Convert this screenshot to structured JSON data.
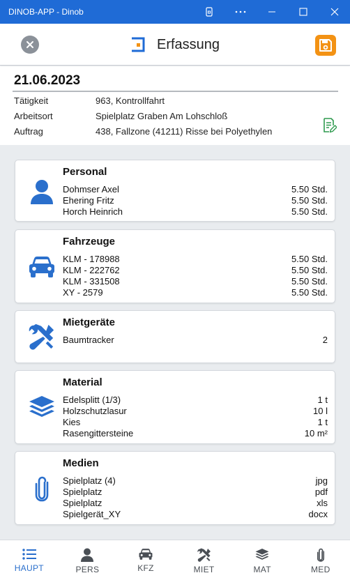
{
  "window": {
    "title": "DINOB-APP - Dinob"
  },
  "header": {
    "title": "Erfassung"
  },
  "info": {
    "date": "21.06.2023",
    "rows": [
      {
        "label": "Tätigkeit",
        "value": "963, Kontrollfahrt"
      },
      {
        "label": "Arbeitsort",
        "value": "Spielplatz Graben Am Lohschloß"
      },
      {
        "label": "Auftrag",
        "value": "438, Fallzone (41211) Risse bei Polyethylen"
      }
    ]
  },
  "cards": [
    {
      "title": "Personal",
      "icon": "person-icon",
      "items": [
        {
          "name": "Dohmser Axel",
          "value": "5.50 Std."
        },
        {
          "name": "Ehering Fritz",
          "value": "5.50 Std."
        },
        {
          "name": "Horch Heinrich",
          "value": "5.50 Std."
        }
      ]
    },
    {
      "title": "Fahrzeuge",
      "icon": "car-icon",
      "items": [
        {
          "name": "KLM - 178988",
          "value": "5.50 Std."
        },
        {
          "name": "KLM - 222762",
          "value": "5.50 Std."
        },
        {
          "name": "KLM - 331508",
          "value": "5.50 Std."
        },
        {
          "name": "XY - 2579",
          "value": "5.50 Std."
        }
      ]
    },
    {
      "title": "Mietgeräte",
      "icon": "tools-icon",
      "items": [
        {
          "name": "Baumtracker",
          "value": "2"
        }
      ]
    },
    {
      "title": "Material",
      "icon": "layers-icon",
      "items": [
        {
          "name": "Edelsplitt (1/3)",
          "value": "1 t"
        },
        {
          "name": "Holzschutzlasur",
          "value": "10 l"
        },
        {
          "name": "Kies",
          "value": "1 t"
        },
        {
          "name": "Rasengittersteine",
          "value": "10 m²"
        }
      ]
    },
    {
      "title": "Medien",
      "icon": "paperclip-icon",
      "items": [
        {
          "name": "Spielplatz (4)",
          "value": "jpg"
        },
        {
          "name": "Spielplatz",
          "value": "pdf"
        },
        {
          "name": "Spielplatz",
          "value": "xls"
        },
        {
          "name": "Spielgerät_XY",
          "value": "docx"
        }
      ]
    }
  ],
  "nav": [
    {
      "label": "HAUPT",
      "icon": "list-icon",
      "active": true
    },
    {
      "label": "PERS",
      "icon": "person-icon",
      "active": false
    },
    {
      "label": "KFZ",
      "icon": "car-icon",
      "active": false
    },
    {
      "label": "MIET",
      "icon": "tools-icon",
      "active": false
    },
    {
      "label": "MAT",
      "icon": "layers-icon",
      "active": false
    },
    {
      "label": "MED",
      "icon": "paperclip-icon",
      "active": false
    }
  ],
  "colors": {
    "titlebar": "#1f6bd6",
    "accent_blue": "#2a6fcc",
    "save_orange": "#f39214",
    "close_grey": "#8b9199",
    "edit_green": "#2e9a4e",
    "nav_grey": "#4a4f55"
  }
}
